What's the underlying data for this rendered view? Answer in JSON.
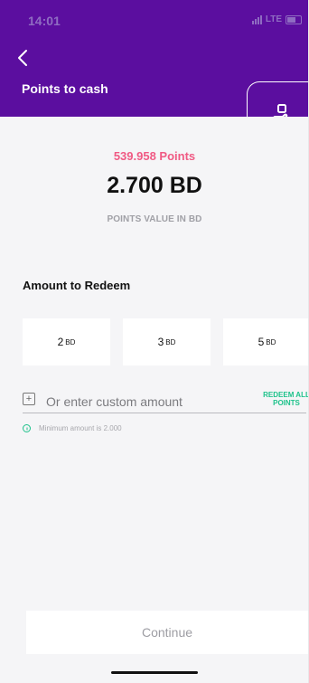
{
  "status_bar": {
    "time": "14:01",
    "carrier": "LTE"
  },
  "header": {
    "title": "Points to cash",
    "back_icon": "chevron-left-icon",
    "action_icon": "hand-with-card-icon"
  },
  "points": {
    "points_text": "539.958 Points",
    "value_text": "2.700 BD",
    "caption": "POINTS VALUE IN BD"
  },
  "amount": {
    "title": "Amount to Redeem",
    "options": [
      {
        "value": "2",
        "unit": "BD"
      },
      {
        "value": "3",
        "unit": "BD"
      },
      {
        "value": "5",
        "unit": "BD"
      }
    ],
    "custom_placeholder": "Or enter custom amount",
    "redeem_all_label": "REDEEM ALL POINTS",
    "minimum_note": "Minimum amount is 2.000"
  },
  "footer": {
    "continue_label": "Continue"
  },
  "colors": {
    "header_purple": "#5b0e9f",
    "points_pink": "#f05a84",
    "accent_green": "#1ec28b"
  }
}
